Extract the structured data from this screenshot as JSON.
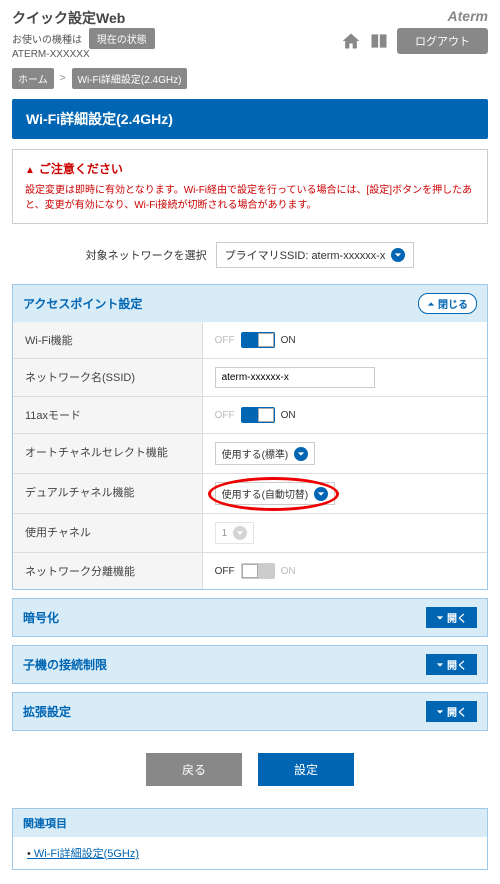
{
  "header": {
    "title": "クイック設定Web",
    "subtitle": "お使いの機種は",
    "model": "ATERM-XXXXXX",
    "status_btn": "現在の状態",
    "brand": "Aterm",
    "logout": "ログアウト"
  },
  "breadcrumb": {
    "home": "ホーム",
    "current": "Wi-Fi詳細設定(2.4GHz)"
  },
  "page_title": "Wi-Fi詳細設定(2.4GHz)",
  "notice": {
    "title": "ご注意ください",
    "text": "設定変更は即時に有効となります。Wi-Fi経由で設定を行っている場合には、[設定]ボタンを押したあと、変更が有効になり、Wi-Fi接続が切断される場合があります。"
  },
  "network_select": {
    "label": "対象ネットワークを選択",
    "value": "プライマリSSID: aterm-xxxxxx-x"
  },
  "sections": {
    "ap": {
      "title": "アクセスポイント設定",
      "collapse": "閉じる",
      "rows": {
        "wifi": {
          "label": "Wi-Fi機能",
          "off": "OFF",
          "on": "ON"
        },
        "ssid": {
          "label": "ネットワーク名(SSID)",
          "value": "aterm-xxxxxx-x"
        },
        "ax": {
          "label": "11axモード",
          "off": "OFF",
          "on": "ON"
        },
        "autoch": {
          "label": "オートチャネルセレクト機能",
          "value": "使用する(標準)"
        },
        "dualch": {
          "label": "デュアルチャネル機能",
          "value": "使用する(自動切替)"
        },
        "usech": {
          "label": "使用チャネル",
          "value": "1"
        },
        "isolate": {
          "label": "ネットワーク分離機能",
          "off": "OFF",
          "on": "ON"
        }
      }
    },
    "encryption": {
      "title": "暗号化",
      "expand": "開く"
    },
    "childlimit": {
      "title": "子機の接続制限",
      "expand": "開く"
    },
    "advanced": {
      "title": "拡張設定",
      "expand": "開く"
    }
  },
  "buttons": {
    "back": "戻る",
    "submit": "設定"
  },
  "related": {
    "title": "関連項目",
    "link": "Wi-Fi詳細設定(5GHz)"
  }
}
